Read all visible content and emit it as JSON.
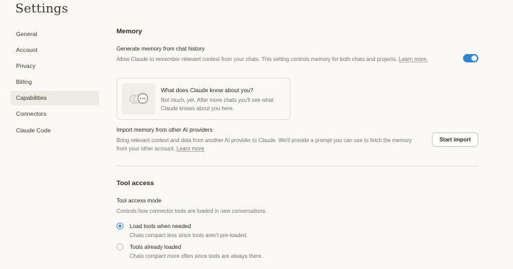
{
  "page": {
    "title": "Settings"
  },
  "sidebar": {
    "items": [
      {
        "label": "General"
      },
      {
        "label": "Account"
      },
      {
        "label": "Privacy"
      },
      {
        "label": "Billing"
      },
      {
        "label": "Capabilities",
        "active": true
      },
      {
        "label": "Connectors"
      },
      {
        "label": "Claude Code"
      }
    ]
  },
  "memory": {
    "heading": "Memory",
    "generate": {
      "label": "Generate memory from chat history",
      "description": "Allow Claude to remember relevant context from your chats. This setting controls memory for both chats and projects.",
      "link": "Learn more.",
      "enabled": true
    },
    "card": {
      "title": "What does Claude know about you?",
      "description": "Not much, yet. After more chats you'll see what Claude knows about you here.",
      "icon": "chat-bubbles-icon"
    },
    "import": {
      "label": "Import memory from other AI providers",
      "description": "Bring relevant context and data from another AI provider to Claude. We'll provide a prompt you can use to fetch the memory from your other account.",
      "link": "Learn more",
      "button": "Start import"
    }
  },
  "tool_access": {
    "heading": "Tool access",
    "mode_label": "Tool access mode",
    "mode_description": "Controls how connector tools are loaded in new conversations.",
    "options": [
      {
        "label": "Load tools when needed",
        "description": "Chats compact less since tools aren't pre-loaded.",
        "selected": true
      },
      {
        "label": "Tools already loaded",
        "description": "Chats compact more often since tools are always there.",
        "selected": false
      }
    ]
  },
  "colors": {
    "background": "#faf9f5",
    "accent": "#2c84db",
    "active_nav": "#ecebe4",
    "text": "#29261b",
    "muted": "#73726c"
  }
}
